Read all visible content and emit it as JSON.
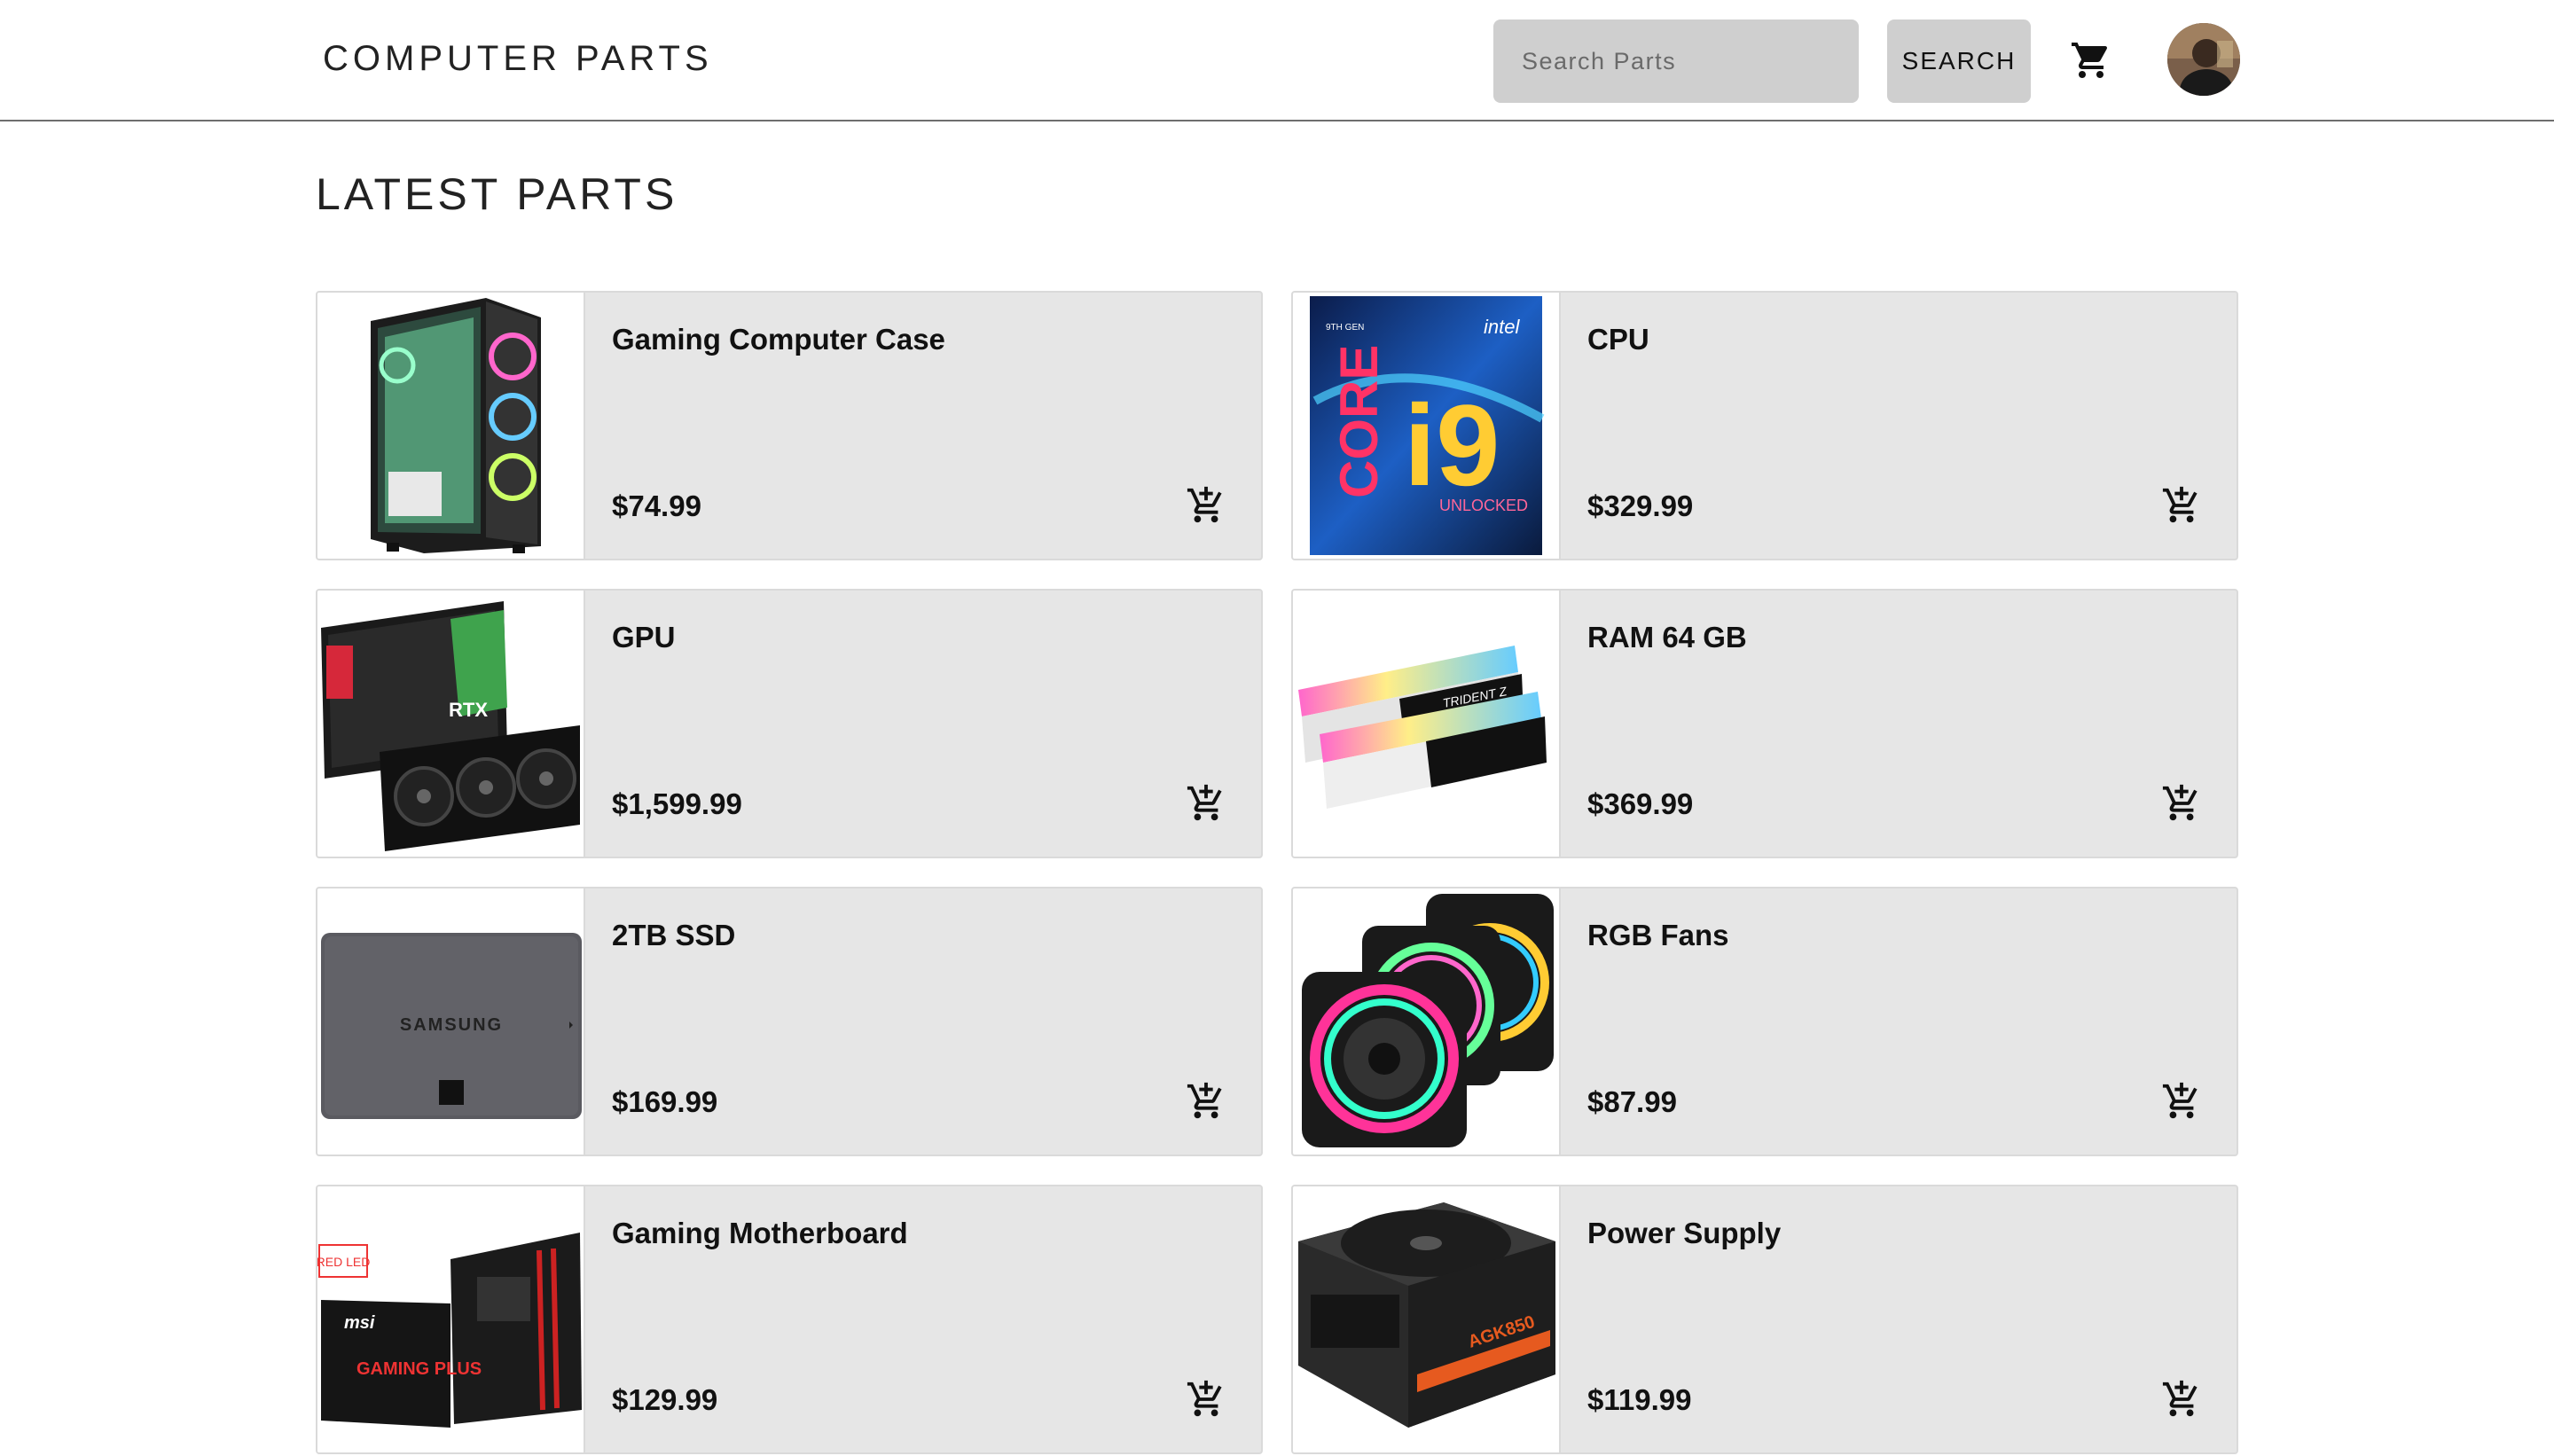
{
  "header": {
    "brand": "COMPUTER PARTS",
    "search_placeholder": "Search Parts",
    "search_button": "SEARCH",
    "cart_icon": "shopping-cart-icon",
    "avatar": "user-avatar"
  },
  "main": {
    "title": "LATEST PARTS",
    "products": [
      {
        "name": "Gaming Computer Case",
        "price": "$74.99",
        "image": "computer-case-image"
      },
      {
        "name": "CPU",
        "price": "$329.99",
        "image": "cpu-box-image"
      },
      {
        "name": "GPU",
        "price": "$1,599.99",
        "image": "graphics-card-image"
      },
      {
        "name": "RAM 64 GB",
        "price": "$369.99",
        "image": "ram-modules-image"
      },
      {
        "name": "2TB SSD",
        "price": "$169.99",
        "image": "ssd-image"
      },
      {
        "name": "RGB Fans",
        "price": "$87.99",
        "image": "rgb-fans-image"
      },
      {
        "name": "Gaming Motherboard",
        "price": "$129.99",
        "image": "motherboard-image"
      },
      {
        "name": "Power Supply",
        "price": "$119.99",
        "image": "power-supply-image"
      }
    ],
    "image_text": {
      "cpu_brand": "intel",
      "cpu_line": "CORE",
      "cpu_model": "i9",
      "cpu_badge": "UNLOCKED",
      "cpu_gen": "9TH GEN",
      "gpu_text": "RTX",
      "ram_text": "TRIDENT Z",
      "ssd_brand": "SAMSUNG",
      "mb_brand": "msi",
      "mb_label": "GAMING PLUS",
      "mb_tag": "RED LED",
      "psu_label": "AGK850"
    },
    "add_to_cart_icon": "add-shopping-cart-icon"
  }
}
